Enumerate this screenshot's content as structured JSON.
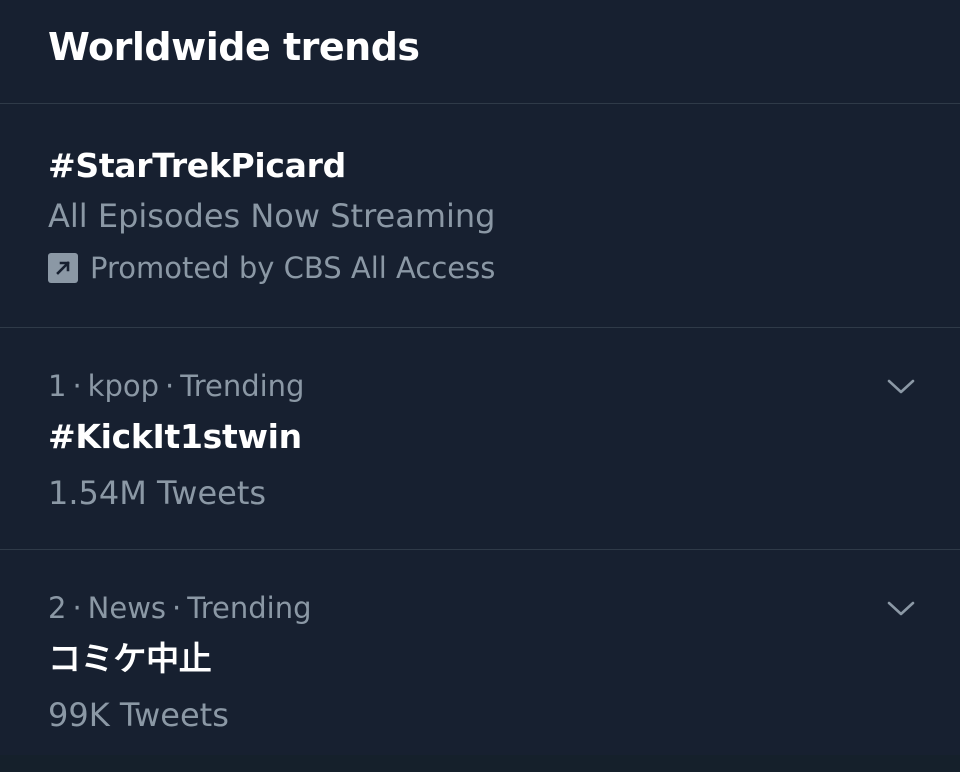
{
  "header": {
    "title": "Worldwide trends"
  },
  "promoted": {
    "hashtag": "#StarTrekPicard",
    "description": "All Episodes Now Streaming",
    "promoted_by": "Promoted by CBS All Access",
    "icon": "promoted-arrow-icon"
  },
  "trends": [
    {
      "rank": "1",
      "category": "kpop",
      "status": "Trending",
      "name": "#KickIt1stwin",
      "count": "1.54M Tweets"
    },
    {
      "rank": "2",
      "category": "News",
      "status": "Trending",
      "name": "コミケ中止",
      "count": "99K Tweets"
    }
  ],
  "colors": {
    "background": "#172030",
    "divider": "#2f3a48",
    "secondary_text": "#8b98a5",
    "primary_text": "#ffffff"
  }
}
